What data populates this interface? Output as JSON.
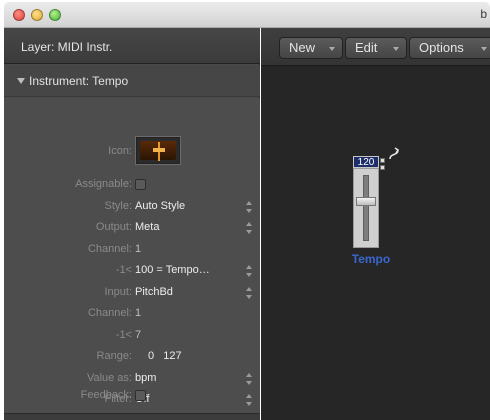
{
  "window": {
    "title_fragment": "b"
  },
  "inspector": {
    "layer_label": "Layer: MIDI Instr.",
    "section_label": "Instrument: Tempo",
    "icon_label": "Icon:",
    "rows": [
      {
        "label": "Assignable:",
        "type": "checkbox"
      },
      {
        "label": "Style:",
        "value": "Auto Style",
        "type": "popup"
      },
      {
        "label": "Output:",
        "value": "Meta",
        "type": "popup"
      },
      {
        "label": "Channel:",
        "value": "1",
        "type": "text"
      },
      {
        "label": "-1<",
        "value": "100 = Tempo…",
        "type": "popup"
      },
      {
        "label": "Input:",
        "value": "PitchBd",
        "type": "popup"
      },
      {
        "label": "Channel:",
        "value": "1",
        "type": "text"
      },
      {
        "label": "-1<",
        "value": "7",
        "type": "text"
      },
      {
        "label": "Range:",
        "value": "0   127",
        "type": "text"
      },
      {
        "label": "Value as:",
        "value": "bpm",
        "type": "popup"
      },
      {
        "label": "Filter:",
        "value": "Off",
        "type": "popup"
      },
      {
        "label": "Feedback:",
        "type": "checkbox"
      }
    ]
  },
  "toolbar": {
    "new_label": "New",
    "edit_label": "Edit",
    "options_label": "Options"
  },
  "fader": {
    "value": "120",
    "name": "Tempo",
    "accent_color": "#3b66d0"
  }
}
